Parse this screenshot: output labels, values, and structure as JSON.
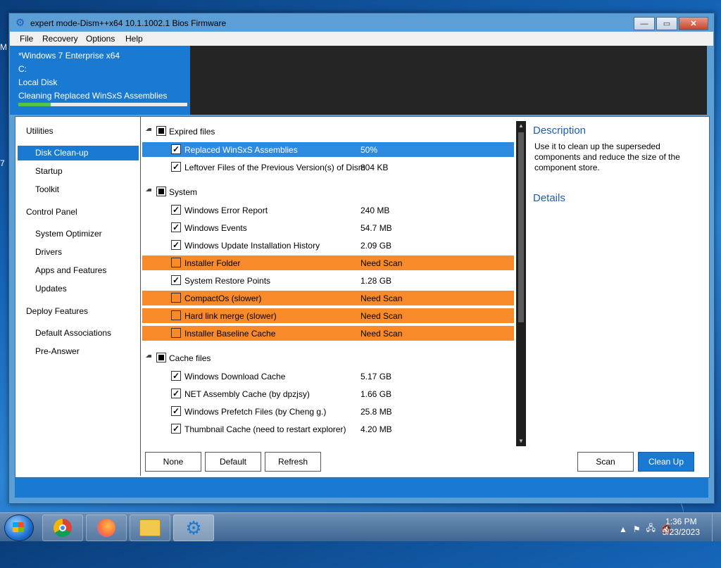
{
  "desktop": {
    "left_label": "M",
    "left_digit": "7"
  },
  "window": {
    "title": "expert mode-Dism++x64 10.1.1002.1 Bios Firmware",
    "buttons": {
      "minimize": "—",
      "maximize": "▭",
      "close": "✕"
    }
  },
  "menu": [
    "File",
    "Recovery",
    "Options",
    "Help"
  ],
  "info": {
    "os": "*Windows 7 Enterprise x64",
    "drive": "C:",
    "disk": "Local Disk",
    "task": "Cleaning Replaced WinSxS Assemblies",
    "progress": 0.19
  },
  "nav": {
    "sections": [
      {
        "label": "Utilities",
        "items": [
          "Disk Clean-up",
          "Startup",
          "Toolkit"
        ]
      },
      {
        "label": "Control Panel",
        "items": [
          "System Optimizer",
          "Drivers",
          "Apps and Features",
          "Updates"
        ]
      },
      {
        "label": "Deploy Features",
        "items": [
          "Default Associations",
          "Pre-Answer"
        ]
      }
    ],
    "selected": "Disk Clean-up"
  },
  "list": {
    "groups": [
      {
        "label": "Expired files",
        "rows": [
          {
            "label": "Replaced WinSxS Assemblies",
            "size": "50%",
            "checked": true,
            "state": "selected"
          },
          {
            "label": "Leftover Files of the Previous Version(s) of Dism",
            "size": "804 KB",
            "checked": true,
            "state": "normal"
          }
        ]
      },
      {
        "label": "System",
        "rows": [
          {
            "label": "Windows Error Report",
            "size": "240 MB",
            "checked": true,
            "state": "normal"
          },
          {
            "label": "Windows Events",
            "size": "54.7 MB",
            "checked": true,
            "state": "normal"
          },
          {
            "label": "Windows Update Installation History",
            "size": "2.09 GB",
            "checked": true,
            "state": "normal"
          },
          {
            "label": "Installer Folder",
            "size": "Need Scan",
            "checked": false,
            "state": "warning"
          },
          {
            "label": "System Restore Points",
            "size": "1.28 GB",
            "checked": true,
            "state": "normal"
          },
          {
            "label": "CompactOs (slower)",
            "size": "Need Scan",
            "checked": false,
            "state": "warning"
          },
          {
            "label": "Hard link merge (slower)",
            "size": "Need Scan",
            "checked": false,
            "state": "warning"
          },
          {
            "label": "Installer Baseline Cache",
            "size": "Need Scan",
            "checked": false,
            "state": "warning"
          }
        ]
      },
      {
        "label": "Cache files",
        "rows": [
          {
            "label": "Windows Download Cache",
            "size": "5.17 GB",
            "checked": true,
            "state": "normal"
          },
          {
            "label": "NET Assembly Cache (by dpzjsy)",
            "size": "1.66 GB",
            "checked": true,
            "state": "normal"
          },
          {
            "label": "Windows Prefetch Files (by Cheng g.)",
            "size": "25.8 MB",
            "checked": true,
            "state": "normal"
          },
          {
            "label": "Thumbnail Cache (need to restart explorer)",
            "size": "4.20 MB",
            "checked": true,
            "state": "normal"
          }
        ]
      }
    ]
  },
  "buttons": {
    "none": "None",
    "default": "Default",
    "refresh": "Refresh",
    "scan": "Scan",
    "cleanup": "Clean Up"
  },
  "description": {
    "title": "Description",
    "text": "Use it to clean up the superseded components and reduce the size of the component store.",
    "details_title": "Details"
  },
  "taskbar": {
    "time": "1:36 PM",
    "date": "5/23/2023",
    "tray_arrow": "▲"
  },
  "colors": {
    "accent": "#1a7ad1",
    "warning": "#f98a2a",
    "selected": "#2c8be0",
    "progress": "#52c24a"
  }
}
